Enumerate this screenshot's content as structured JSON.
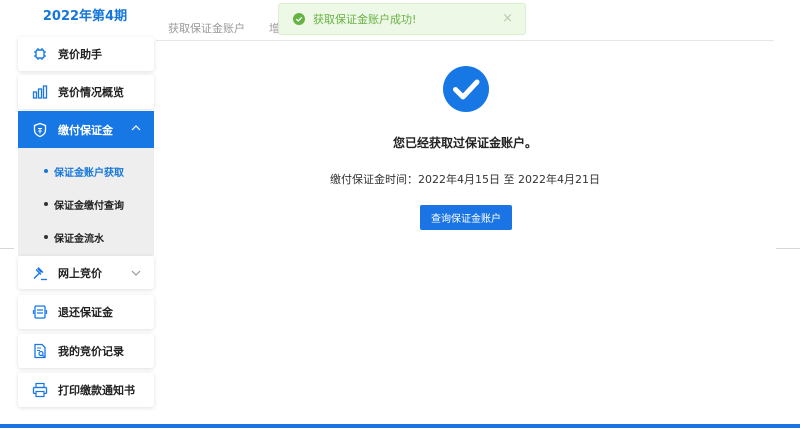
{
  "sidebar": {
    "period_title": "2022年第4期",
    "items": [
      {
        "label": "竞价助手",
        "icon": "chip-icon"
      },
      {
        "label": "竞价情况概览",
        "icon": "bar-chart-icon"
      },
      {
        "label": "缴付保证金",
        "icon": "shield-icon"
      },
      {
        "label": "网上竞价",
        "icon": "gavel-icon"
      },
      {
        "label": "退还保证金",
        "icon": "printer-return-icon"
      },
      {
        "label": "我的竞价记录",
        "icon": "document-search-icon"
      },
      {
        "label": "打印缴款通知书",
        "icon": "printer-icon"
      }
    ],
    "sub_items": [
      {
        "label": "保证金账户获取"
      },
      {
        "label": "保证金缴付查询"
      },
      {
        "label": "保证金流水"
      }
    ]
  },
  "tabs": [
    {
      "label": "获取保证金账户"
    },
    {
      "label": "增"
    }
  ],
  "toast": {
    "message": "获取保证金账户成功!",
    "close": "×"
  },
  "main": {
    "result_text": "您已经获取过保证金账户。",
    "period_text": "缴付保证金时间：2022年4月15日 至 2022年4月21日",
    "query_button": "查询保证金账户"
  },
  "colors": {
    "accent": "#1677e5",
    "success": "#67b244",
    "toast_bg": "#eef8e6"
  }
}
